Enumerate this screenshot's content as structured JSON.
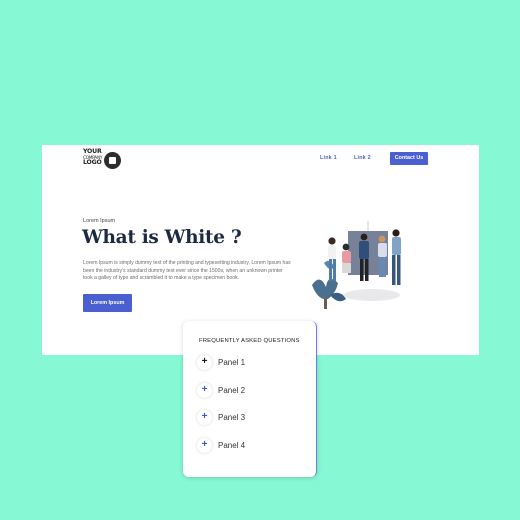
{
  "header": {
    "logo_lines": [
      "YOUR",
      "COMPANY",
      "LOGO"
    ],
    "nav": [
      "Link 1",
      "Link 2"
    ],
    "contact_label": "Contact Us"
  },
  "hero": {
    "eyebrow": "Lorem Ipsum",
    "title": "What is White ?",
    "body": "Lorem Ipsum is simply dummy text of the printing and typesetting industry. Lorem Ipsum has been the industry's standard dummy text ever since the 1500s, when an unknown printer took a galley of type and scrambled it to make a type specimen book.",
    "button_label": "Lorem Ipsum",
    "illustration_icon": "team-meeting-illustration"
  },
  "faq": {
    "title": "FREQUENTLY ASKED QUESTIONS",
    "panels": [
      {
        "label": "Panel 1",
        "icon": "plus-icon"
      },
      {
        "label": "Panel 2",
        "icon": "plus-icon"
      },
      {
        "label": "Panel 3",
        "icon": "plus-icon"
      },
      {
        "label": "Panel 4",
        "icon": "plus-icon"
      }
    ]
  },
  "colors": {
    "background": "#86f8d4",
    "accent": "#4a5fd0",
    "title": "#1d2a44"
  }
}
